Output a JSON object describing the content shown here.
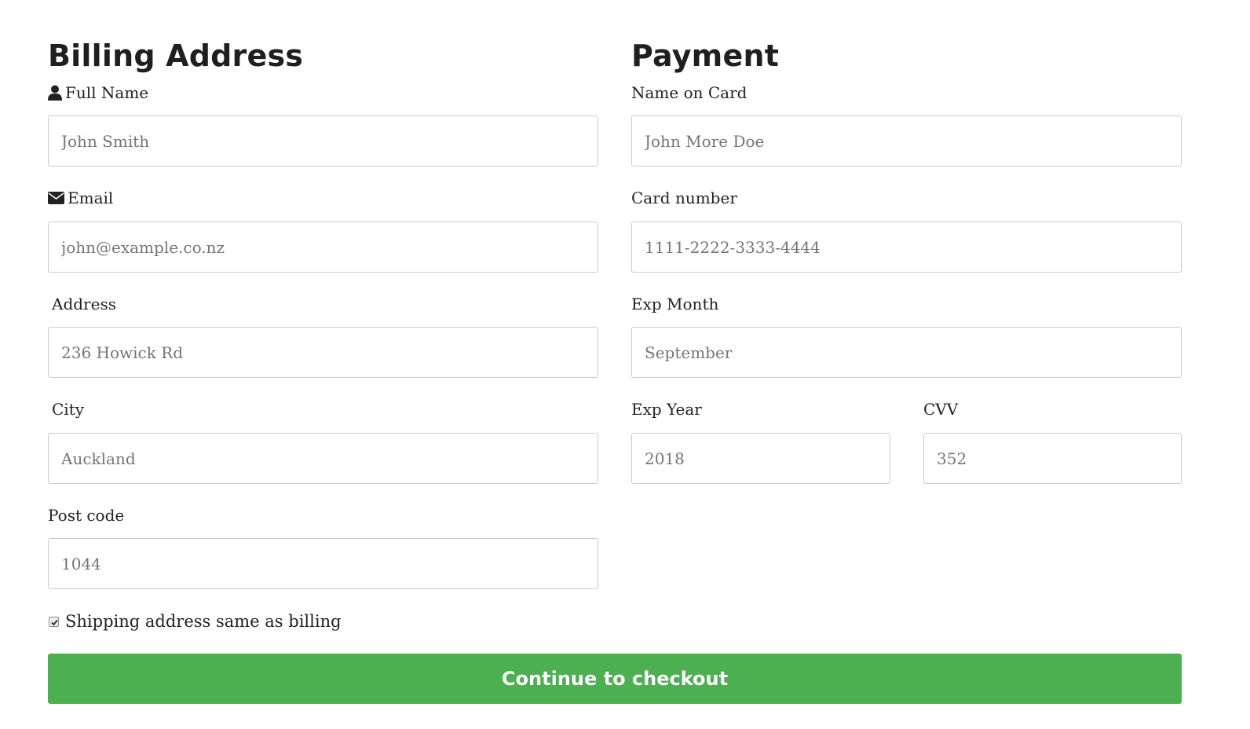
{
  "billing": {
    "heading": "Billing Address",
    "fields": {
      "full_name": {
        "label": "Full Name",
        "icon": "user-icon",
        "placeholder": "John Smith",
        "value": ""
      },
      "email": {
        "label": "Email",
        "icon": "envelope-icon",
        "placeholder": "john@example.co.nz",
        "value": ""
      },
      "address": {
        "label": "Address",
        "placeholder": "236 Howick Rd",
        "value": ""
      },
      "city": {
        "label": "City",
        "placeholder": "Auckland",
        "value": ""
      },
      "post_code": {
        "label": "Post code",
        "placeholder": "1044",
        "value": ""
      }
    }
  },
  "payment": {
    "heading": "Payment",
    "fields": {
      "name_on_card": {
        "label": "Name on Card",
        "placeholder": "John More Doe",
        "value": ""
      },
      "card_number": {
        "label": "Card number",
        "placeholder": "1111-2222-3333-4444",
        "value": ""
      },
      "exp_month": {
        "label": "Exp Month",
        "placeholder": "September",
        "value": ""
      },
      "exp_year": {
        "label": "Exp Year",
        "placeholder": "2018",
        "value": ""
      },
      "cvv": {
        "label": "CVV",
        "placeholder": "352",
        "value": ""
      }
    }
  },
  "shipping_same": {
    "label": "Shipping address same as billing",
    "checked": true
  },
  "submit": {
    "label": "Continue to checkout"
  },
  "colors": {
    "accent": "#4caf50",
    "text": "#222222",
    "placeholder": "#757575",
    "border": "#cccccc"
  }
}
